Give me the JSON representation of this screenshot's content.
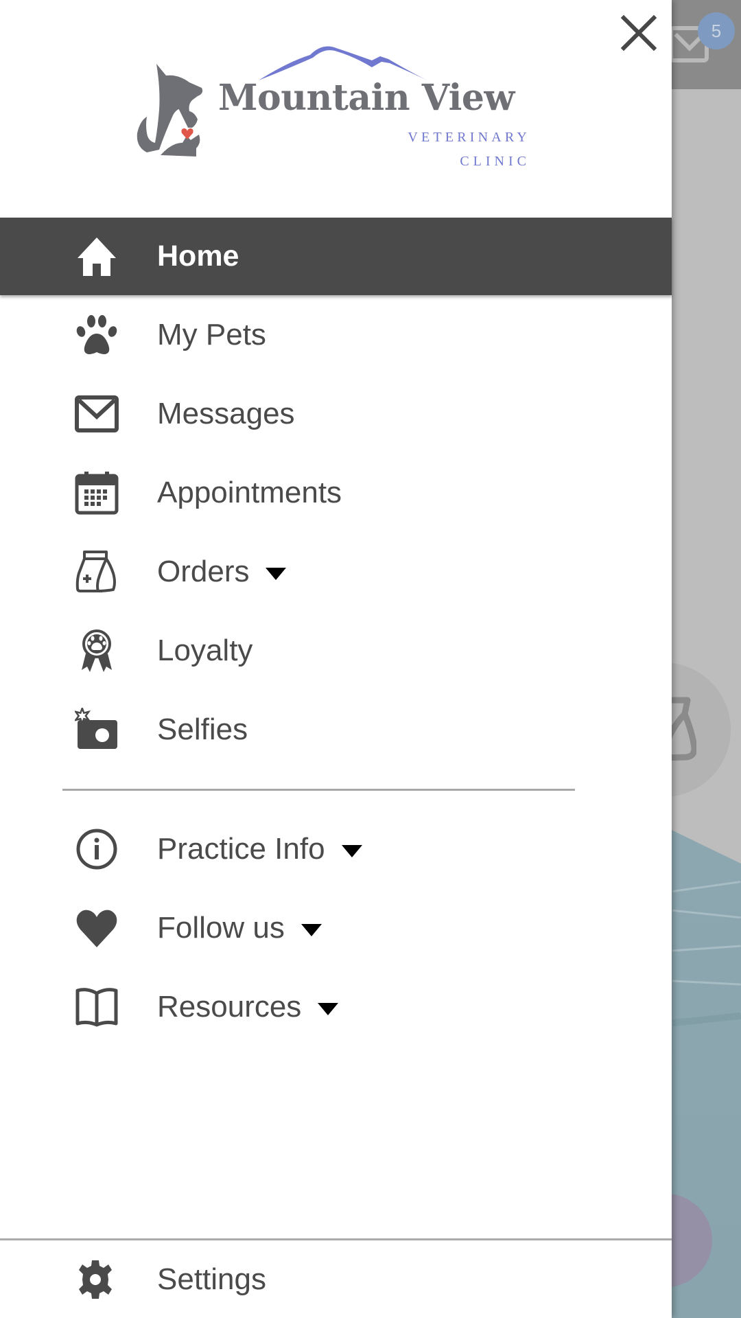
{
  "background": {
    "mail_badge_count": "5",
    "badge_color": "#7f9ac0"
  },
  "drawer": {
    "close_icon": "close-icon",
    "logo": {
      "title": "Mountain View",
      "subtitle_line1": "VETERINARY",
      "subtitle_line2": "CLINIC",
      "brand_gray": "#6f7075",
      "brand_blue": "#7078d0",
      "heart_color": "#e0574a"
    },
    "active_color": "#4a4a4a",
    "primary_items": [
      {
        "label": "Home",
        "icon": "home-icon",
        "active": true,
        "has_dropdown": false
      },
      {
        "label": "My Pets",
        "icon": "paw-icon",
        "active": false,
        "has_dropdown": false
      },
      {
        "label": "Messages",
        "icon": "envelope-icon",
        "active": false,
        "has_dropdown": false
      },
      {
        "label": "Appointments",
        "icon": "calendar-icon",
        "active": false,
        "has_dropdown": false
      },
      {
        "label": "Orders",
        "icon": "medicine-bag-icon",
        "active": false,
        "has_dropdown": true
      },
      {
        "label": "Loyalty",
        "icon": "award-ribbon-icon",
        "active": false,
        "has_dropdown": false
      },
      {
        "label": "Selfies",
        "icon": "camera-star-icon",
        "active": false,
        "has_dropdown": false
      }
    ],
    "secondary_items": [
      {
        "label": "Practice Info",
        "icon": "info-icon",
        "has_dropdown": true
      },
      {
        "label": "Follow us",
        "icon": "heart-icon",
        "has_dropdown": true
      },
      {
        "label": "Resources",
        "icon": "book-icon",
        "has_dropdown": true
      }
    ],
    "footer_item": {
      "label": "Settings",
      "icon": "gear-icon"
    }
  }
}
